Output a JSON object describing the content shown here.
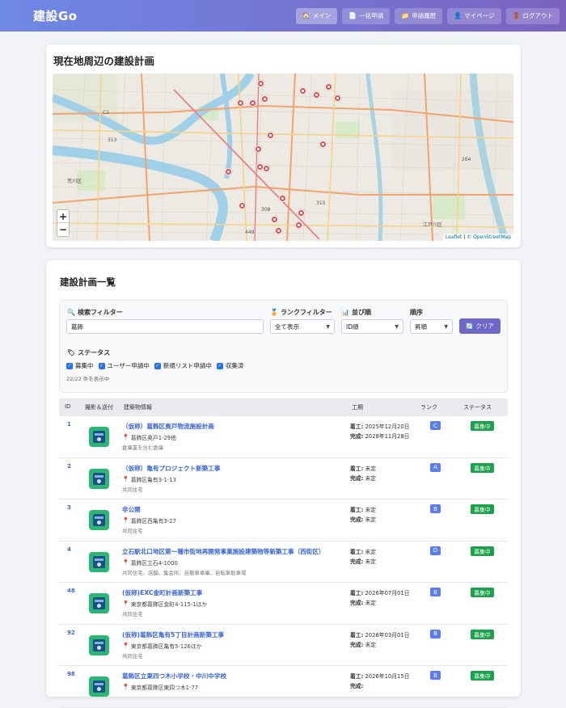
{
  "header": {
    "logo": "建設Go",
    "nav": [
      {
        "label": "メイン",
        "icon": "home-icon",
        "glyph": "🏠"
      },
      {
        "label": "一括申請",
        "icon": "document-icon",
        "glyph": "📄"
      },
      {
        "label": "申請履歴",
        "icon": "folder-icon",
        "glyph": "📁"
      },
      {
        "label": "マイページ",
        "icon": "user-icon",
        "glyph": "👤"
      },
      {
        "label": "ログアウト",
        "icon": "door-icon",
        "glyph": "🚪"
      }
    ]
  },
  "map": {
    "title": "現在地周辺の建設計画",
    "zoom_in": "+",
    "zoom_out": "−",
    "attribution_leaflet": "Leaflet",
    "attribution_sep": "|",
    "attribution_osm": "© OpenStreetMap",
    "labels": [
      "荒川区",
      "C2",
      "313",
      "315",
      "308",
      "449",
      "264",
      "江戸川区"
    ],
    "marker_count": 20
  },
  "list": {
    "title": "建設計画一覧",
    "search_label": "検索フィルター",
    "search_value": "葛飾",
    "rank_label": "ランクフィルター",
    "rank_value": "全て表示",
    "sort_label": "並び順",
    "sort_value": "ID順",
    "order_label": "順序",
    "order_value": "昇順",
    "clear_label": "クリア",
    "status_label": "ステータス",
    "checks": [
      "募集中",
      "ユーザー申請中",
      "新規リスト申請中",
      "収集済"
    ],
    "count_text": "22/22 件を表示中",
    "columns": [
      "ID",
      "撮影＆送付",
      "建築物情報",
      "工期",
      "ランク",
      "ステータス"
    ],
    "start_prefix": "着工:",
    "end_prefix": "完成:",
    "rows": [
      {
        "id": "1",
        "name": "（仮称）葛飾区奥戸物流施設計画",
        "address": "葛飾区奥戸1-29他",
        "use": "倉庫業を含む倉庫",
        "start": "2025年12月20日",
        "end": "2028年11月28日",
        "rank": "C",
        "status": "募集中"
      },
      {
        "id": "2",
        "name": "（仮称）亀有プロジェクト新築工事",
        "address": "葛飾区亀有3-1-13",
        "use": "共同住宅",
        "start": "未定",
        "end": "未定",
        "rank": "A",
        "status": "募集中"
      },
      {
        "id": "3",
        "name": "非公開",
        "address": "葛飾区西亀有3-27",
        "use": "共同住宅",
        "start": "未定",
        "end": "未定",
        "rank": "B",
        "status": "募集中"
      },
      {
        "id": "4",
        "name": "立石駅北口地区第一種市街地再開発事業施設建築物等新築工事（西街区）",
        "address": "葛飾区立石4-1000",
        "use": "共同住宅、店舗、集会所、自動車車庫、自転車駐車場",
        "start": "未定",
        "end": "未定",
        "rank": "D",
        "status": "募集中"
      },
      {
        "id": "48",
        "name": "(仮称)EXC金町計画新築工事",
        "address": "東京都葛飾区金町4-115-1ほか",
        "use": "共同住宅",
        "start": "2026年07月01日",
        "end": "未定",
        "rank": "B",
        "status": "募集中"
      },
      {
        "id": "92",
        "name": "(仮称)葛飾区亀有5丁目計画新築工事",
        "address": "東京都葛飾区亀有5-126ほか",
        "use": "共同住宅",
        "start": "2026年03月01日",
        "end": "未定",
        "rank": "B",
        "status": "募集中"
      },
      {
        "id": "98",
        "name": "葛飾区立東四つ木小学校・中川中学校",
        "address": "東京都葛飾区東四つ木1-77",
        "use": "",
        "start": "2026年10月15日",
        "end": "",
        "rank": "B",
        "status": "募集中"
      }
    ]
  }
}
